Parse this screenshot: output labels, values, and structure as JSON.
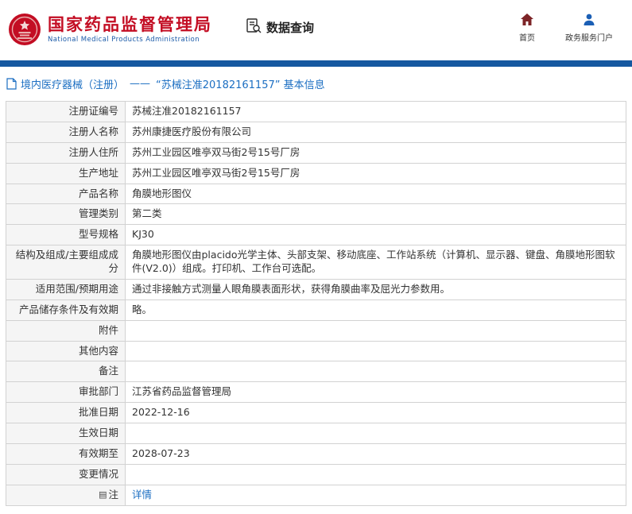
{
  "header": {
    "agency_cn": "国家药品监督管理局",
    "agency_en": "National Medical Products Administration",
    "section_title": "数据查询",
    "nav": {
      "home": "首页",
      "portal": "政务服务门户"
    }
  },
  "breadcrumb": {
    "category": "境内医疗器械（注册）",
    "separator": "——",
    "current": "“苏械注准20182161157” 基本信息"
  },
  "table": {
    "rows": [
      {
        "label": "注册证编号",
        "value": "苏械注准20182161157"
      },
      {
        "label": "注册人名称",
        "value": "苏州康捷医疗股份有限公司"
      },
      {
        "label": "注册人住所",
        "value": "苏州工业园区唯亭双马街2号15号厂房"
      },
      {
        "label": "生产地址",
        "value": "苏州工业园区唯亭双马街2号15号厂房"
      },
      {
        "label": "产品名称",
        "value": "角膜地形图仪"
      },
      {
        "label": "管理类别",
        "value": "第二类"
      },
      {
        "label": "型号规格",
        "value": "KJ30"
      },
      {
        "label": "结构及组成/主要组成成分",
        "value": "角膜地形图仪由placido光学主体、头部支架、移动底座、工作站系统（计算机、显示器、键盘、角膜地形图软件(V2.0)）组成。打印机、工作台可选配。"
      },
      {
        "label": "适用范围/预期用途",
        "value": "通过非接触方式测量人眼角膜表面形状，获得角膜曲率及屈光力参数用。"
      },
      {
        "label": "产品储存条件及有效期",
        "value": "略。"
      },
      {
        "label": "附件",
        "value": ""
      },
      {
        "label": "其他内容",
        "value": ""
      },
      {
        "label": "备注",
        "value": ""
      },
      {
        "label": "审批部门",
        "value": "江苏省药品监督管理局"
      },
      {
        "label": "批准日期",
        "value": "2022-12-16"
      },
      {
        "label": "生效日期",
        "value": ""
      },
      {
        "label": "有效期至",
        "value": "2028-07-23"
      },
      {
        "label": "变更情况",
        "value": ""
      },
      {
        "label": "注",
        "value": "详情",
        "is_link": true,
        "has_icon": true
      }
    ]
  },
  "colors": {
    "brand_red": "#c30d23",
    "brand_blue": "#1a5aa8",
    "bar_blue": "#1558a0",
    "link_blue": "#1b6ec2",
    "label_bg": "#f5f5f5"
  }
}
